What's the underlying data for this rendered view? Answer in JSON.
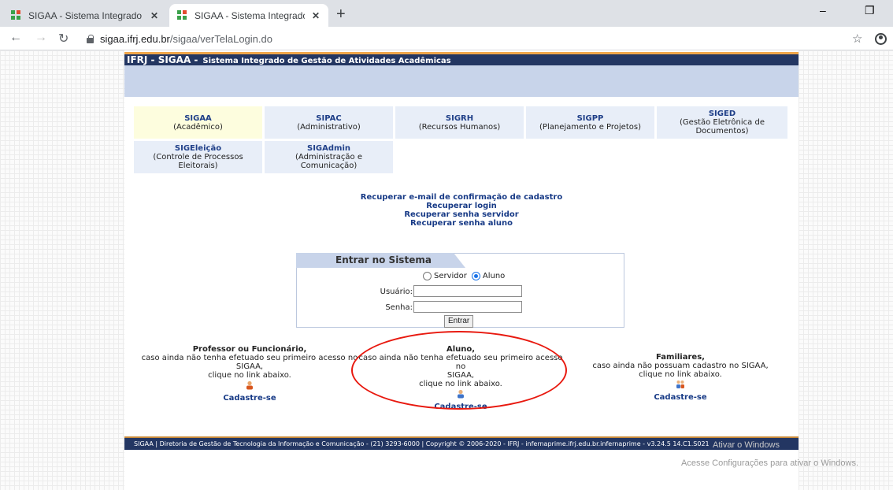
{
  "browser": {
    "tabs": [
      {
        "title": "SIGAA - Sistema Integrado de Ge",
        "active": false
      },
      {
        "title": "SIGAA - Sistema Integrado de Ge",
        "active": true
      }
    ],
    "new_tab": "+",
    "url_domain": "sigaa.ifrj.edu.br",
    "url_path": "/sigaa/verTelaLogin.do",
    "minimize": "–",
    "restore": "❐"
  },
  "header": {
    "brand": "IFRJ - SIGAA -",
    "subtitle": "Sistema Integrado de Gestão de Atividades Acadêmicas"
  },
  "modules": [
    {
      "name": "SIGAA",
      "desc": "(Acadêmico)",
      "selected": true
    },
    {
      "name": "SIPAC",
      "desc": "(Administrativo)"
    },
    {
      "name": "SIGRH",
      "desc": "(Recursos Humanos)"
    },
    {
      "name": "SIGPP",
      "desc": "(Planejamento e Projetos)"
    },
    {
      "name": "SIGED",
      "desc": "(Gestão Eletrônica de Documentos)"
    },
    {
      "name": "SIGEleição",
      "desc": "(Controle de Processos Eleitorais)"
    },
    {
      "name": "SIGAdmin",
      "desc": "(Administração e Comunicação)"
    }
  ],
  "recovery_links": [
    "Recuperar e-mail de confirmação de cadastro",
    "Recuperar login",
    "Recuperar senha servidor",
    "Recuperar senha aluno"
  ],
  "login": {
    "caption": "Entrar no Sistema",
    "option_servidor": "Servidor",
    "option_aluno": "Aluno",
    "selected_option": "Aluno",
    "user_label": "Usuário:",
    "password_label": "Senha:",
    "user_value": "",
    "password_value": "",
    "submit": "Entrar"
  },
  "registration": [
    {
      "title": "Professor ou Funcionário,",
      "line1": "caso ainda não tenha efetuado seu primeiro acesso no",
      "line2": "SIGAA,",
      "line3": "clique no link abaixo.",
      "link": "Cadastre-se",
      "icon": "professor-icon"
    },
    {
      "title": "Aluno,",
      "line1": "caso ainda não tenha efetuado seu primeiro acesso no",
      "line2": "SIGAA,",
      "line3": "clique no link abaixo.",
      "link": "Cadastre-se",
      "icon": "student-icon"
    },
    {
      "title": "Familiares,",
      "line1": "caso ainda não possuam cadastro no SIGAA,",
      "line2": "clique no link abaixo.",
      "line3": "",
      "link": "Cadastre-se",
      "icon": "family-icon"
    }
  ],
  "footer": {
    "text": "SIGAA | Diretoria de Gestão de Tecnologia da Informação e Comunicação - (21) 3293-6000 | Copyright © 2006-2020 - IFRJ - infernaprime.ifrj.edu.br.infernaprime - v3.24.5 14.C1.S021"
  },
  "watermark": {
    "line1": "Ativar o Windows",
    "line2": "Acesse Configurações para ativar o Windows."
  },
  "colors": {
    "header_bg": "#233662",
    "accent_orange": "#f0a64a",
    "banner_bg": "#c8d4ea",
    "link_blue": "#173a86",
    "highlight_ellipse": "#e8190f"
  }
}
